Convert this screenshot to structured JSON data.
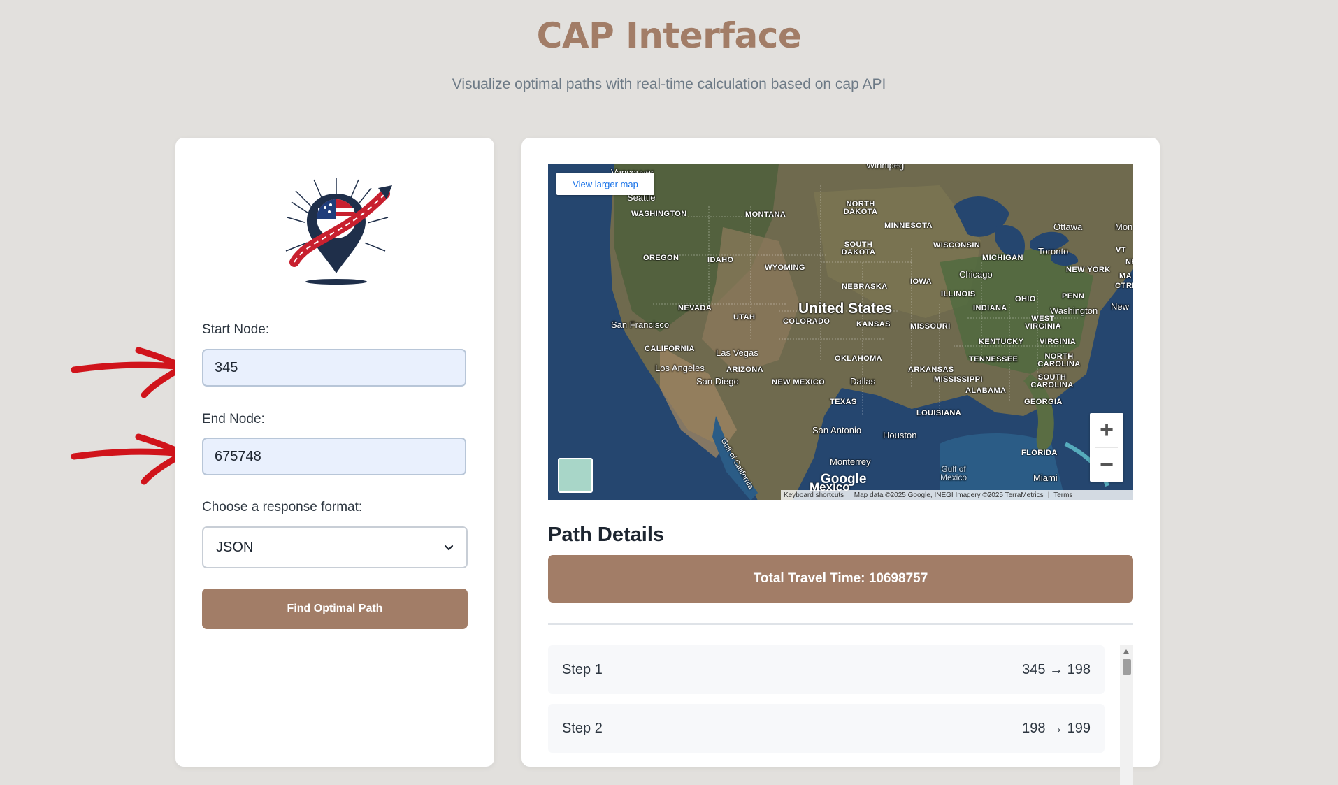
{
  "header": {
    "title": "CAP Interface",
    "subtitle": "Visualize optimal paths with real-time calculation based on cap API"
  },
  "form": {
    "start_label": "Start Node:",
    "start_value": "345",
    "end_label": "End Node:",
    "end_value": "675748",
    "format_label": "Choose a response format:",
    "format_selected": "JSON",
    "submit_label": "Find Optimal Path"
  },
  "map": {
    "view_larger_label": "View larger map",
    "zoom_in_label": "+",
    "zoom_out_label": "−",
    "google_label": "Google",
    "shortcuts_label": "Keyboard shortcuts",
    "attribution": "Map data ©2025 Google, INEGI Imagery ©2025 TerraMetrics",
    "terms_label": "Terms",
    "labels": {
      "winnipeg": "Winnipeg",
      "vancouver": "Vancouver",
      "seattle": "Seattle",
      "washington_state": "WASHINGTON",
      "montana": "MONTANA",
      "north_dakota": "NORTH DAKOTA",
      "minnesota": "MINNESOTA",
      "ottawa": "Ottawa",
      "montreal": "Mon",
      "oregon": "OREGON",
      "idaho": "IDAHO",
      "south_dakota": "SOUTH DAKOTA",
      "wisconsin": "WISCONSIN",
      "michigan": "MICHIGAN",
      "toronto": "Toronto",
      "vermont": "VT",
      "new_hampshire": "NH",
      "wyoming": "WYOMING",
      "new_york": "NEW YORK",
      "massachusetts": "MA",
      "connecticut": "CT",
      "rhode_island": "RI",
      "iowa": "IOWA",
      "chicago": "Chicago",
      "nebraska": "NEBRASKA",
      "illinois": "ILLINOIS",
      "pennsylvania": "PENN",
      "ohio": "OHIO",
      "new_york_city": "New",
      "nevada": "NEVADA",
      "united_states": "United States",
      "indiana": "INDIANA",
      "washington_dc": "Washington",
      "utah": "UTAH",
      "san_francisco": "San Francisco",
      "colorado": "COLORADO",
      "kansas": "KANSAS",
      "missouri": "MISSOURI",
      "west_virginia": "WEST VIRGINIA",
      "kentucky": "KENTUCKY",
      "virginia": "VIRGINIA",
      "california": "CALIFORNIA",
      "las_vegas": "Las Vegas",
      "oklahoma": "OKLAHOMA",
      "tennessee": "TENNESSEE",
      "north_carolina": "NORTH CAROLINA",
      "los_angeles": "Los Angeles",
      "arizona": "ARIZONA",
      "arkansas": "ARKANSAS",
      "new_mexico": "NEW MEXICO",
      "san_diego": "San Diego",
      "dallas": "Dallas",
      "mississippi": "MISSISSIPPI",
      "south_carolina": "SOUTH CAROLINA",
      "alabama": "ALABAMA",
      "texas": "TEXAS",
      "georgia": "GEORGIA",
      "louisiana": "LOUISIANA",
      "san_antonio": "San Antonio",
      "houston": "Houston",
      "gulf_of_california": "Gulf of California",
      "florida": "FLORIDA",
      "monterrey": "Monterrey",
      "gulf_of_mexico": "Gulf of Mexico",
      "mexico": "Mexico",
      "miami": "Miami"
    }
  },
  "details": {
    "title": "Path Details",
    "total_label": "Total Travel Time: 10698757",
    "steps": [
      {
        "label": "Step 1",
        "route": "345 → 198"
      },
      {
        "label": "Step 2",
        "route": "198 → 199"
      }
    ]
  },
  "colors": {
    "accent": "#a27d67",
    "background": "#e2e0dd",
    "annotation_arrow": "#d0141b"
  }
}
